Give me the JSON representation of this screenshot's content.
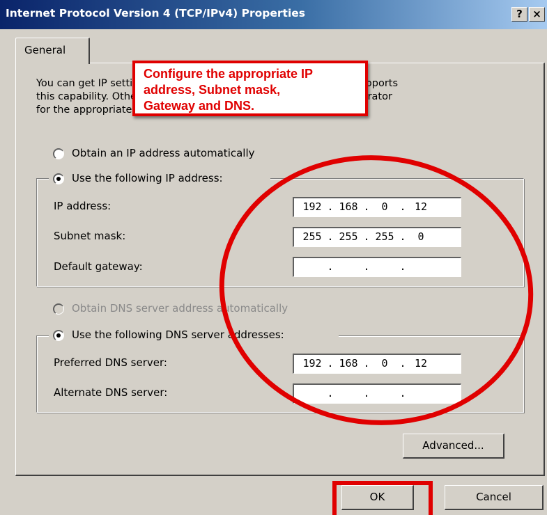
{
  "window": {
    "title": "Internet Protocol Version 4 (TCP/IPv4) Properties",
    "help_glyph": "?",
    "close_glyph": "×"
  },
  "tabs": [
    {
      "label": "General",
      "selected": true
    }
  ],
  "intro_text": "You can get IP settings assigned automatically if your network supports\nthis capability. Otherwise, you need to ask your network administrator\nfor the appropriate IP settings.",
  "callout": {
    "text": "Configure the appropriate IP\naddress, Subnet mask,\nGateway and DNS.",
    "color": "#e00000"
  },
  "ip_settings": {
    "auto_option": {
      "label": "Obtain an IP address automatically",
      "selected": false
    },
    "manual_option": {
      "label": "Use the following IP address:",
      "selected": true
    },
    "fields": [
      {
        "label": "IP address:",
        "octets": [
          "192",
          "168",
          "0",
          "12"
        ]
      },
      {
        "label": "Subnet mask:",
        "octets": [
          "255",
          "255",
          "255",
          "0"
        ]
      },
      {
        "label": "Default gateway:",
        "octets": [
          "",
          "",
          "",
          ""
        ]
      }
    ]
  },
  "dns_settings": {
    "auto_option": {
      "label": "Obtain DNS server address automatically",
      "selected": false,
      "enabled": false
    },
    "manual_option": {
      "label": "Use the following DNS server addresses:",
      "selected": true
    },
    "fields": [
      {
        "label": "Preferred DNS server:",
        "octets": [
          "192",
          "168",
          "0",
          "12"
        ]
      },
      {
        "label": "Alternate DNS server:",
        "octets": [
          "",
          "",
          "",
          ""
        ]
      }
    ]
  },
  "buttons": {
    "advanced": "Advanced...",
    "ok": "OK",
    "cancel": "Cancel"
  },
  "colors": {
    "title_gradient_start": "#0a246a",
    "title_gradient_end": "#a6caf0",
    "dialog_face": "#d4d0c8",
    "annotation_red": "#e00000"
  }
}
